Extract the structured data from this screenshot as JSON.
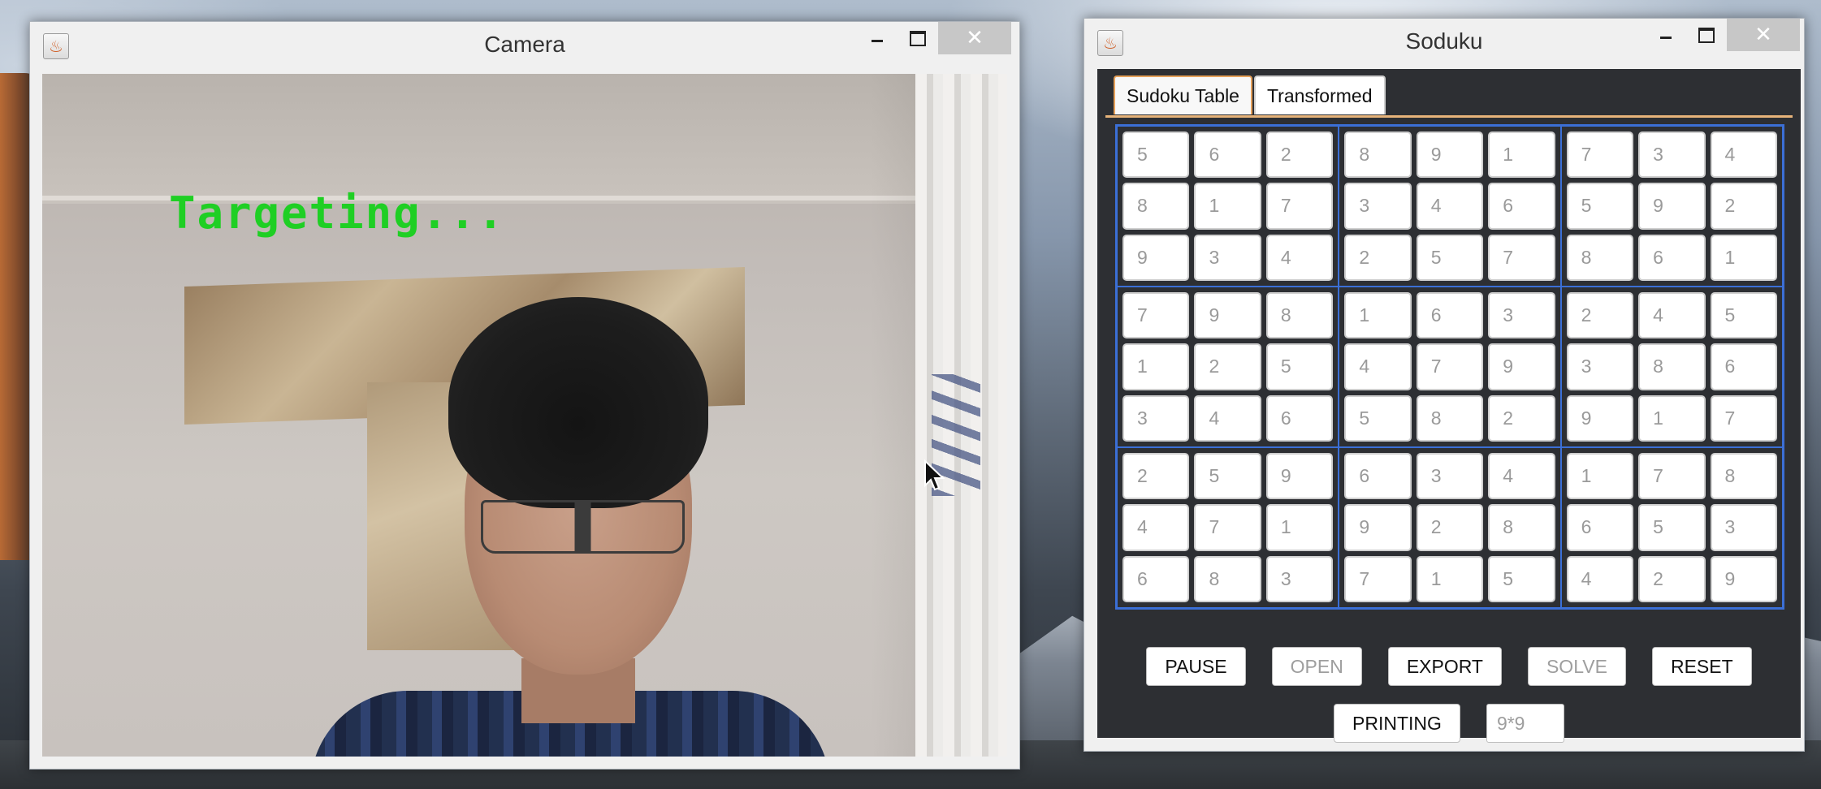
{
  "camera_window": {
    "title": "Camera",
    "status_text": "Targeting...",
    "minimize": "–",
    "close": "✕"
  },
  "soduku_window": {
    "title": "Soduku",
    "minimize": "–",
    "close": "✕",
    "tabs": [
      {
        "label": "Sudoku Table",
        "active": true
      },
      {
        "label": "Transformed",
        "active": false
      }
    ],
    "grid": [
      [
        "5",
        "6",
        "2",
        "8",
        "9",
        "1",
        "7",
        "3",
        "4"
      ],
      [
        "8",
        "1",
        "7",
        "3",
        "4",
        "6",
        "5",
        "9",
        "2"
      ],
      [
        "9",
        "3",
        "4",
        "2",
        "5",
        "7",
        "8",
        "6",
        "1"
      ],
      [
        "7",
        "9",
        "8",
        "1",
        "6",
        "3",
        "2",
        "4",
        "5"
      ],
      [
        "1",
        "2",
        "5",
        "4",
        "7",
        "9",
        "3",
        "8",
        "6"
      ],
      [
        "3",
        "4",
        "6",
        "5",
        "8",
        "2",
        "9",
        "1",
        "7"
      ],
      [
        "2",
        "5",
        "9",
        "6",
        "3",
        "4",
        "1",
        "7",
        "8"
      ],
      [
        "4",
        "7",
        "1",
        "9",
        "2",
        "8",
        "6",
        "5",
        "3"
      ],
      [
        "6",
        "8",
        "3",
        "7",
        "1",
        "5",
        "4",
        "2",
        "9"
      ]
    ],
    "buttons": [
      {
        "label": "PAUSE",
        "enabled": true
      },
      {
        "label": "OPEN",
        "enabled": false
      },
      {
        "label": "EXPORT",
        "enabled": true
      },
      {
        "label": "SOLVE",
        "enabled": false
      },
      {
        "label": "RESET",
        "enabled": true
      }
    ],
    "printing_button": "PRINTING",
    "size_field_value": "9*9"
  },
  "colors": {
    "status_green": "#1fcf24",
    "grid_blue": "#3b6fd6",
    "panel_dark": "#2d2f33",
    "tab_accent": "#e6b37a"
  }
}
